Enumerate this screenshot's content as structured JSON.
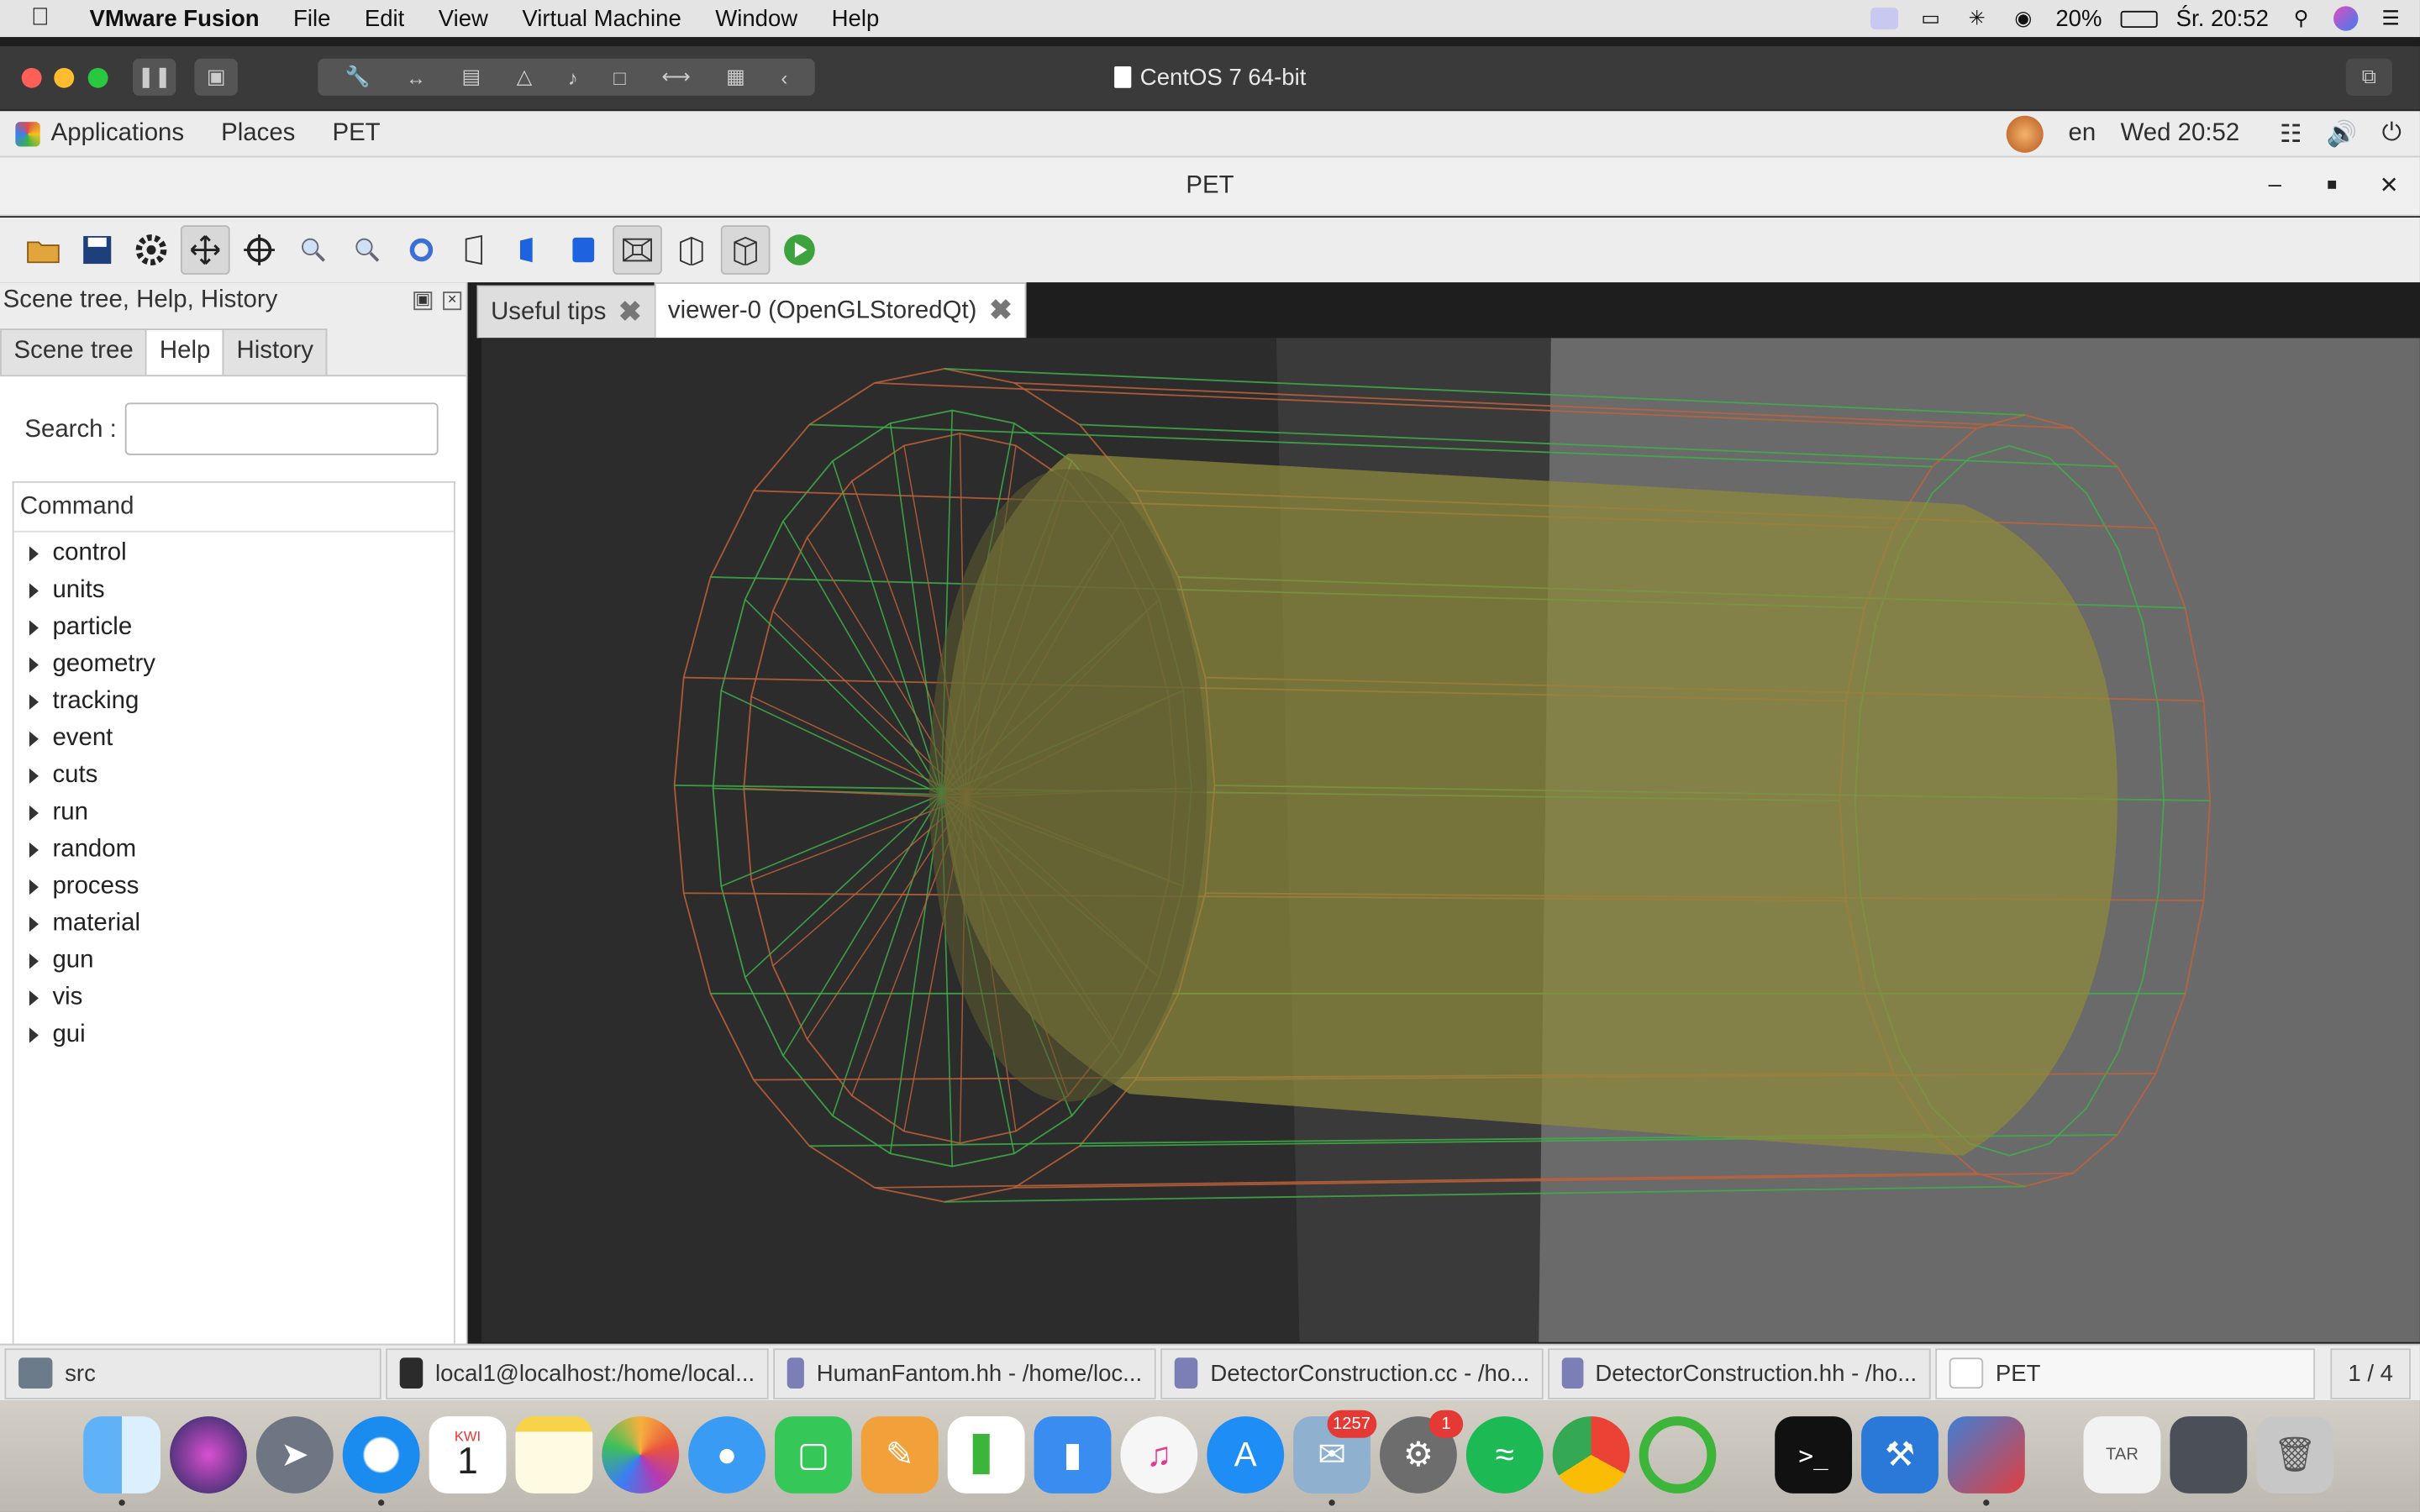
{
  "macos": {
    "app_name": "VMware Fusion",
    "menu": [
      "File",
      "Edit",
      "View",
      "Virtual Machine",
      "Window",
      "Help"
    ],
    "battery": "20%",
    "clock": "Śr. 20:52"
  },
  "vmware": {
    "title": "CentOS 7 64-bit"
  },
  "gnome": {
    "menu": [
      "Applications",
      "Places",
      "PET"
    ],
    "language": "en",
    "clock": "Wed 20:52"
  },
  "pet": {
    "title": "PET"
  },
  "dock": {
    "title": "Scene tree, Help, History",
    "tabs": [
      "Scene tree",
      "Help",
      "History"
    ],
    "active_tab": "Help",
    "search_label": "Search :",
    "search_value": "",
    "tree_header": "Command",
    "commands": [
      "control",
      "units",
      "particle",
      "geometry",
      "tracking",
      "event",
      "cuts",
      "run",
      "random",
      "process",
      "material",
      "gun",
      "vis",
      "gui"
    ]
  },
  "viewer": {
    "tabs": [
      "Useful tips",
      "viewer-0 (OpenGLStoredQt)"
    ],
    "active_tab": "viewer-0 (OpenGLStoredQt)"
  },
  "taskbar": {
    "items": [
      "src",
      "local1@localhost:/home/local...",
      "HumanFantom.hh - /home/loc...",
      "DetectorConstruction.cc - /ho...",
      "DetectorConstruction.hh - /ho...",
      "PET"
    ],
    "pager": "1 / 4"
  },
  "macdock": {
    "calendar_month": "KWI",
    "calendar_day": "1",
    "mail_badge": "1257",
    "prefs_badge": "1"
  },
  "colors": {
    "wire_orange": "#c0623a",
    "wire_green": "#3fae4a",
    "cylinder": "#8f8a3c",
    "viewer_bg": "#2c2c2c"
  }
}
